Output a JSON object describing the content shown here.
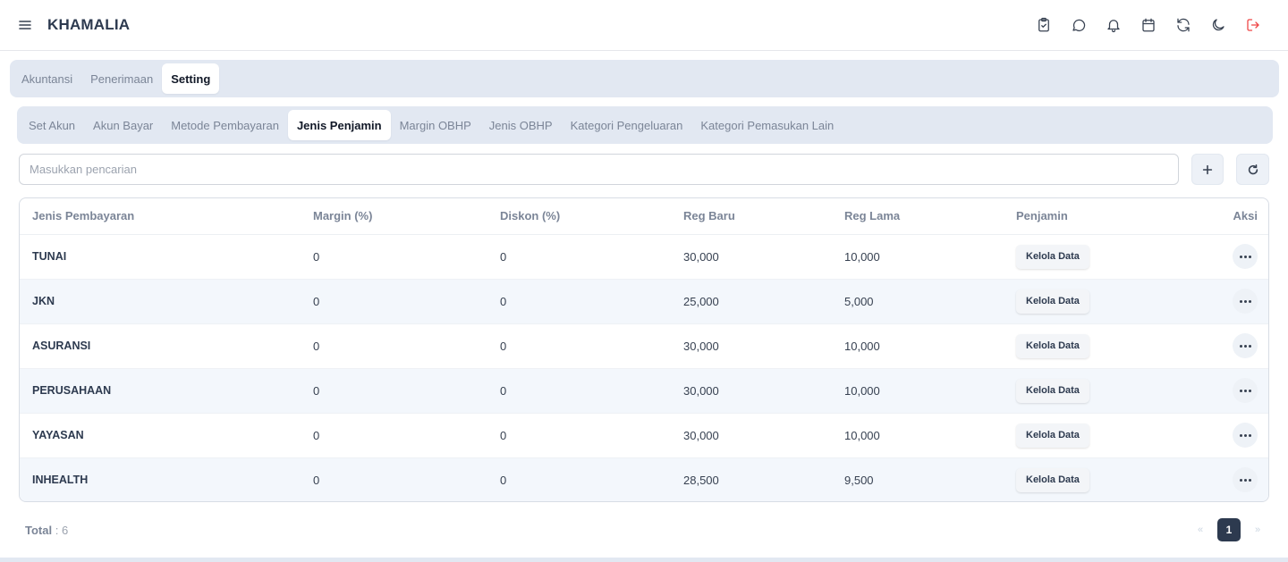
{
  "app": {
    "brand": "KHAMALIA"
  },
  "topbar": {
    "icons": [
      "menu-icon",
      "clipboard-check-icon",
      "chat-icon",
      "bell-icon",
      "calendar-icon",
      "refresh-icon",
      "moon-icon",
      "logout-icon"
    ],
    "logout_color": "#ef4444"
  },
  "main_tabs": [
    {
      "label": "Akuntansi",
      "active": false
    },
    {
      "label": "Penerimaan",
      "active": false
    },
    {
      "label": "Setting",
      "active": true
    }
  ],
  "sub_tabs": [
    {
      "label": "Set Akun",
      "active": false
    },
    {
      "label": "Akun Bayar",
      "active": false
    },
    {
      "label": "Metode Pembayaran",
      "active": false
    },
    {
      "label": "Jenis Penjamin",
      "active": true
    },
    {
      "label": "Margin OBHP",
      "active": false
    },
    {
      "label": "Jenis OBHP",
      "active": false
    },
    {
      "label": "Kategori Pengeluaran",
      "active": false
    },
    {
      "label": "Kategori Pemasukan Lain",
      "active": false
    }
  ],
  "search": {
    "placeholder": "Masukkan pencarian",
    "value": ""
  },
  "table": {
    "headers": {
      "jenis": "Jenis Pembayaran",
      "margin": "Margin (%)",
      "diskon": "Diskon (%)",
      "reg_baru": "Reg Baru",
      "reg_lama": "Reg Lama",
      "penjamin": "Penjamin",
      "aksi": "Aksi"
    },
    "manage_label": "Kelola Data",
    "rows": [
      {
        "jenis": "TUNAI",
        "margin": "0",
        "diskon": "0",
        "reg_baru": "30,000",
        "reg_lama": "10,000"
      },
      {
        "jenis": "JKN",
        "margin": "0",
        "diskon": "0",
        "reg_baru": "25,000",
        "reg_lama": "5,000"
      },
      {
        "jenis": "ASURANSI",
        "margin": "0",
        "diskon": "0",
        "reg_baru": "30,000",
        "reg_lama": "10,000"
      },
      {
        "jenis": "PERUSAHAAN",
        "margin": "0",
        "diskon": "0",
        "reg_baru": "30,000",
        "reg_lama": "10,000"
      },
      {
        "jenis": "YAYASAN",
        "margin": "0",
        "diskon": "0",
        "reg_baru": "30,000",
        "reg_lama": "10,000"
      },
      {
        "jenis": "INHEALTH",
        "margin": "0",
        "diskon": "0",
        "reg_baru": "28,500",
        "reg_lama": "9,500"
      }
    ]
  },
  "footer": {
    "total_label": "Total",
    "total_value": ": 6",
    "current_page": "1",
    "prev": "«",
    "next": "»"
  },
  "colors": {
    "brand_text": "#2d3a4f",
    "tab_bg": "#e2e8f2",
    "row_alt": "#f3f7fc",
    "page_active": "#2d3a4f"
  }
}
